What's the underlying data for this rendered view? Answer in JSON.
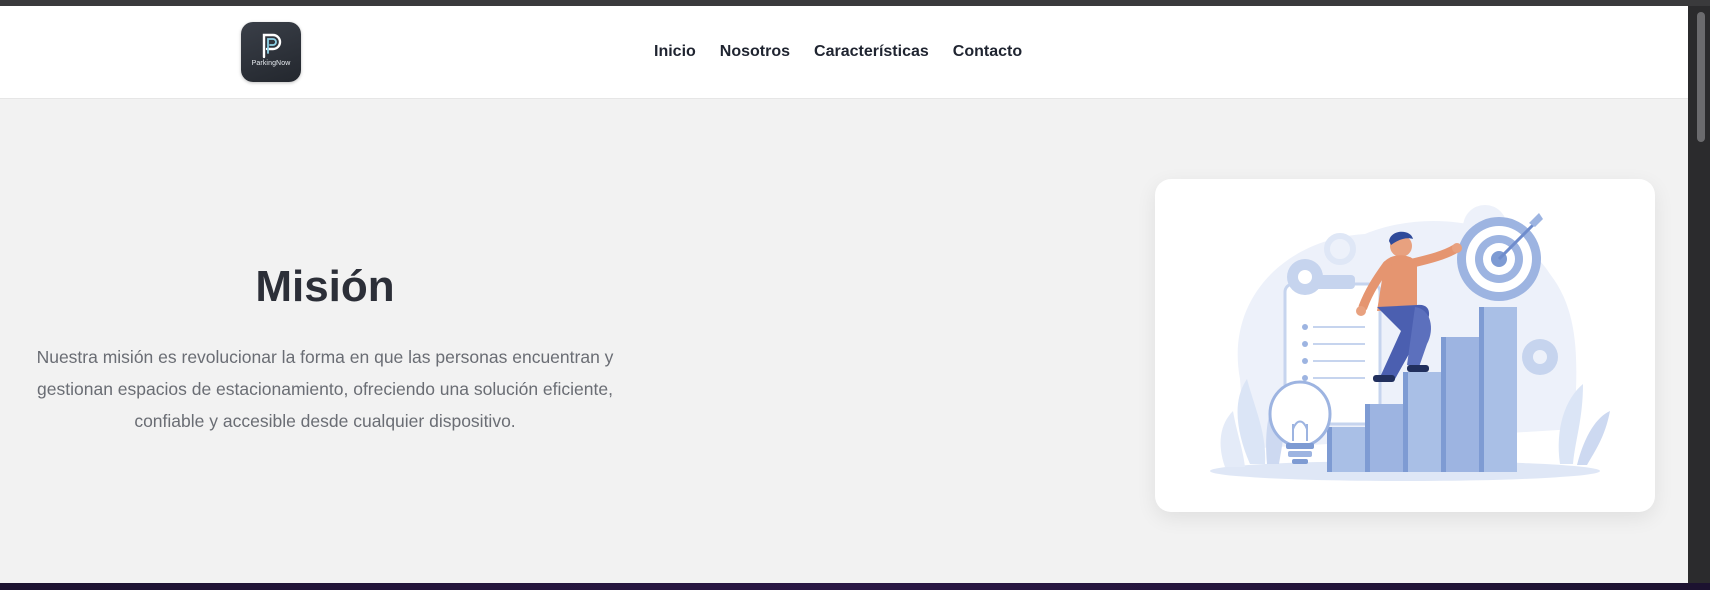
{
  "brand": {
    "name": "ParkingNow"
  },
  "nav": {
    "items": [
      {
        "label": "Inicio"
      },
      {
        "label": "Nosotros"
      },
      {
        "label": "Características"
      },
      {
        "label": "Contacto"
      }
    ]
  },
  "mission": {
    "title": "Misión",
    "body": "Nuestra misión es revolucionar la forma en que las personas encuentran y gestionan espacios de estacionamiento, ofreciendo una solución eficiente, confiable y accesible desde cualquier dispositivo."
  },
  "colors": {
    "page_bg": "#f2f2f2",
    "nav_bg": "#ffffff",
    "text_dark": "#2c2f38",
    "text_muted": "#6a6d74",
    "illustration_blue": "#a9bfe6",
    "illustration_accent": "#e59570"
  },
  "icons": {
    "logo": "parking-p-logo-icon",
    "illustration": "growth-target-illustration"
  }
}
